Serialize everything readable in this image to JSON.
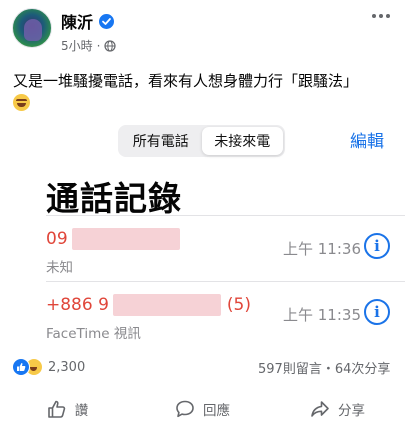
{
  "post": {
    "author": "陳沂",
    "time": "5小時",
    "separator": "·",
    "text": "又是一堆騷擾電話，看來有人想身體力行「跟騷法」"
  },
  "screenshot": {
    "tabs": [
      {
        "label": "所有電話",
        "active": false
      },
      {
        "label": "未接來電",
        "active": true
      }
    ],
    "edit_label": "編輯",
    "title": "通話記錄",
    "calls": [
      {
        "number": "09",
        "subtitle": "未知",
        "time": "上午 11:36",
        "suffix": ""
      },
      {
        "number": "+886 9",
        "subtitle": "FaceTime 視訊",
        "time": "上午 11:35",
        "suffix": "(5)"
      }
    ],
    "accent_color": "#1a73e8",
    "missed_color": "#e0463a"
  },
  "engagement": {
    "reaction_count": "2,300",
    "stats": "597則留言・64次分享"
  },
  "actions": {
    "like_label": "讚",
    "comment_label": "回應",
    "share_label": "分享"
  },
  "icons": [
    "verified-badge-icon",
    "globe-icon",
    "more-icon",
    "info-icon",
    "like-icon",
    "haha-icon",
    "comment-icon",
    "share-icon"
  ]
}
